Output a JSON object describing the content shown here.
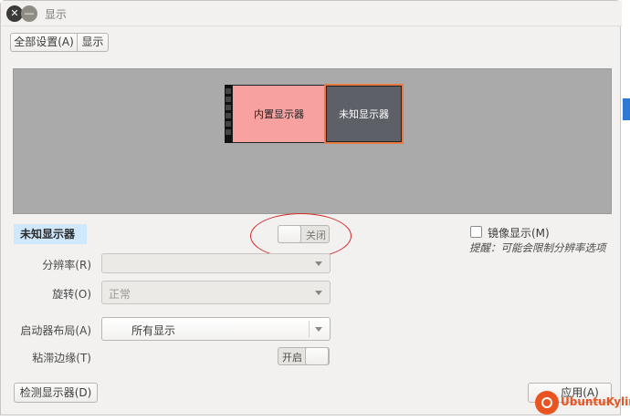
{
  "window": {
    "title": "显示"
  },
  "breadcrumb": {
    "all_settings": "全部设置(A)",
    "current": "显示"
  },
  "arrangement": {
    "monitors": [
      {
        "label": "内置显示器",
        "color": "#f7a1a1"
      },
      {
        "label": "未知显示器",
        "color": "#5d6167"
      }
    ]
  },
  "selected_monitor": {
    "name": "未知显示器"
  },
  "power": {
    "state_label": "关闭"
  },
  "mirror": {
    "label": "镜像显示(M)",
    "checked": false,
    "hint": "提醒：可能会限制分辨率选项"
  },
  "form": {
    "resolution": {
      "label": "分辨率(R)",
      "value": ""
    },
    "rotation": {
      "label": "旋转(O)",
      "value": "正常"
    },
    "launcher": {
      "label": "启动器布局(A)",
      "value": "所有显示"
    },
    "sticky_edges": {
      "label": "粘滞边缘(T)",
      "state_label": "开启"
    }
  },
  "footer": {
    "detect_label": "检测显示器(D)",
    "apply_label": "应用(A)"
  },
  "watermark": {
    "text": "UbuntuKylin"
  },
  "colors": {
    "accent_orange": "#e95420",
    "annotation_red": "#d42a2a",
    "selection_blue": "#cfe8fb"
  }
}
